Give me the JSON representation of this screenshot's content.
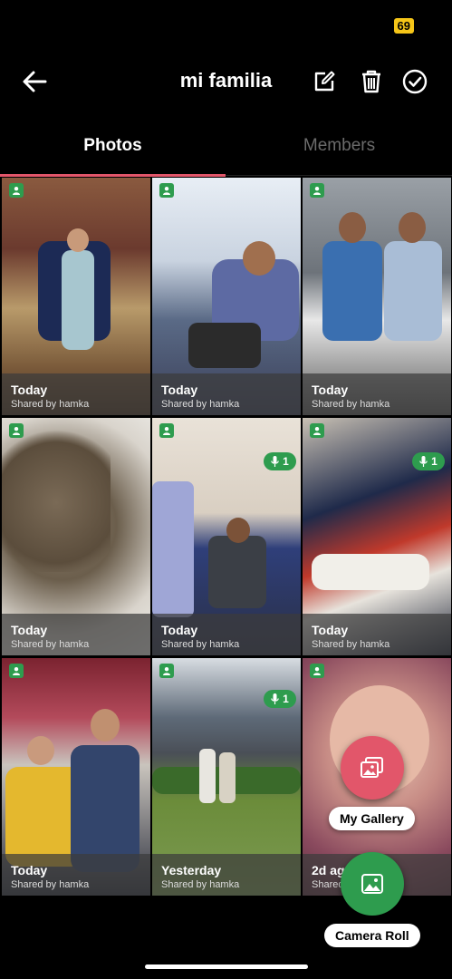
{
  "status_bar": {
    "battery": "69"
  },
  "header": {
    "title": "mi familia",
    "back_icon": "arrow-left-icon",
    "actions": [
      "edit-icon",
      "trash-icon",
      "check-circle-icon"
    ]
  },
  "tabs": [
    {
      "label": "Photos",
      "active": true
    },
    {
      "label": "Members",
      "active": false
    }
  ],
  "photos": [
    {
      "date": "Today",
      "shared_by": "Shared by hamka",
      "voice_notes": null
    },
    {
      "date": "Today",
      "shared_by": "Shared by hamka",
      "voice_notes": null
    },
    {
      "date": "Today",
      "shared_by": "Shared by hamka",
      "voice_notes": null
    },
    {
      "date": "Today",
      "shared_by": "Shared by hamka",
      "voice_notes": null
    },
    {
      "date": "Today",
      "shared_by": "Shared by hamka",
      "voice_notes": "1"
    },
    {
      "date": "Today",
      "shared_by": "Shared by hamka",
      "voice_notes": "1"
    },
    {
      "date": "Today",
      "shared_by": "Shared by hamka",
      "voice_notes": null
    },
    {
      "date": "Yesterday",
      "shared_by": "Shared by hamka",
      "voice_notes": "1"
    },
    {
      "date": "2d ago",
      "shared_by": "Shared by hamka",
      "voice_notes": null
    }
  ],
  "fab": {
    "gallery_label": "My Gallery",
    "camera_roll_label": "Camera Roll"
  },
  "colors": {
    "accent": "#e2566a",
    "owner_badge": "#2e9c4e",
    "gallery_fab": "#e2566a",
    "camera_fab": "#2e9c4e"
  }
}
